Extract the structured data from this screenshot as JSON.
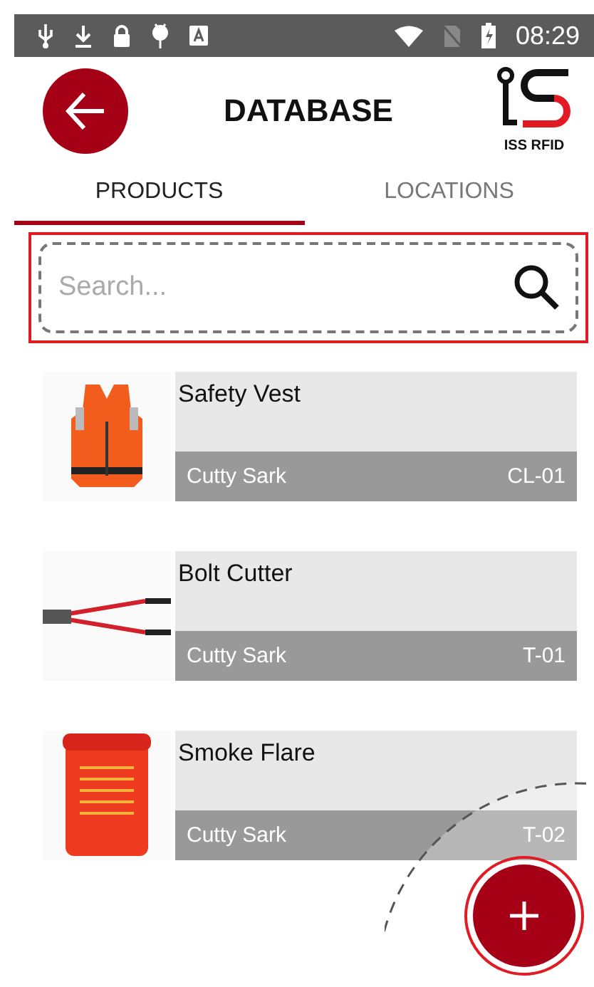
{
  "status_bar": {
    "time": "08:29"
  },
  "header": {
    "title": "DATABASE",
    "logo_text": "ISS RFID"
  },
  "tabs": [
    {
      "label": "PRODUCTS",
      "selected": true
    },
    {
      "label": "LOCATIONS",
      "selected": false
    }
  ],
  "search": {
    "placeholder": "Search..."
  },
  "products": [
    {
      "name": "Safety Vest",
      "location": "Cutty Sark",
      "code": "CL-01",
      "kind": "vest"
    },
    {
      "name": "Bolt Cutter",
      "location": "Cutty Sark",
      "code": "T-01",
      "kind": "cutter"
    },
    {
      "name": "Smoke Flare",
      "location": "Cutty Sark",
      "code": "T-02",
      "kind": "flare"
    }
  ]
}
